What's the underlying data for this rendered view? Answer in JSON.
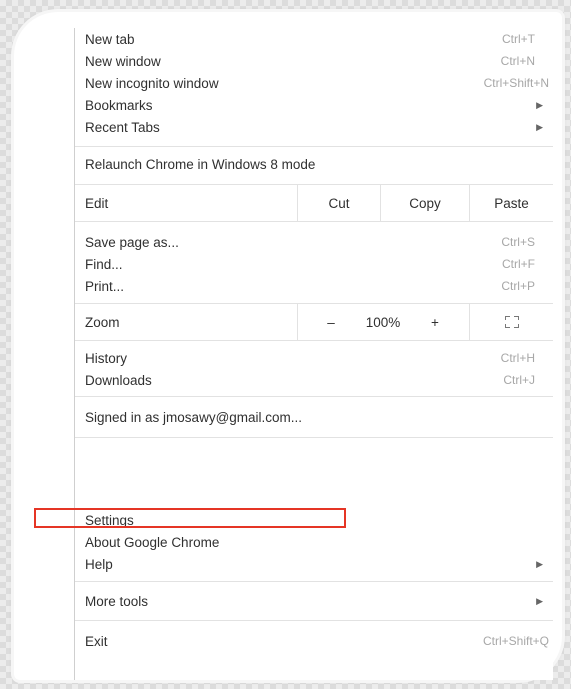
{
  "menu": {
    "items": [
      {
        "label": "New tab",
        "shortcut": "Ctrl+T"
      },
      {
        "label": "New window",
        "shortcut": "Ctrl+N"
      },
      {
        "label": "New incognito window",
        "shortcut": "Ctrl+Shift+N"
      },
      {
        "label": "Bookmarks",
        "shortcut": ""
      },
      {
        "label": "Recent Tabs",
        "shortcut": ""
      }
    ],
    "relaunch": "Relaunch Chrome in Windows 8 mode",
    "edit": {
      "label": "Edit",
      "cut": "Cut",
      "copy": "Copy",
      "paste": "Paste"
    },
    "page_items": [
      {
        "label": "Save page as...",
        "shortcut": "Ctrl+S"
      },
      {
        "label": "Find...",
        "shortcut": "Ctrl+F"
      },
      {
        "label": "Print...",
        "shortcut": "Ctrl+P"
      }
    ],
    "zoom": {
      "label": "Zoom",
      "minus": "–",
      "value": "100%",
      "plus": "+"
    },
    "history_items": [
      {
        "label": "History",
        "shortcut": "Ctrl+H"
      },
      {
        "label": "Downloads",
        "shortcut": "Ctrl+J"
      }
    ],
    "signed_in": "Signed in as jmosawy@gmail.com...",
    "settings_items": [
      {
        "label": "Settings"
      },
      {
        "label": "About Google Chrome"
      },
      {
        "label": "Help"
      }
    ],
    "more_tools": "More tools",
    "exit": {
      "label": "Exit",
      "shortcut": "Ctrl+Shift+Q"
    }
  },
  "colors": {
    "highlight": "#e53525",
    "shortcut_text": "#a7a7a7"
  }
}
